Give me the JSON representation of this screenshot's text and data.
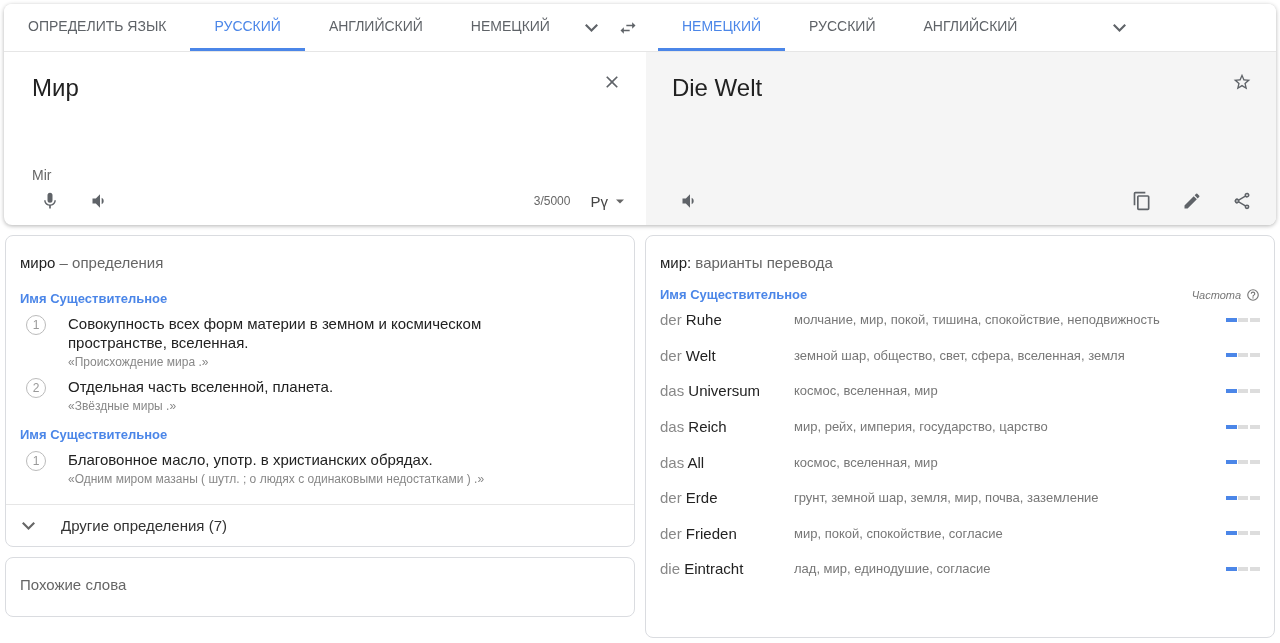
{
  "source_tabs": [
    {
      "label": "ОПРЕДЕЛИТЬ ЯЗЫК",
      "selected": false
    },
    {
      "label": "РУССКИЙ",
      "selected": true
    },
    {
      "label": "АНГЛИЙСКИЙ",
      "selected": false
    },
    {
      "label": "НЕМЕЦКИЙ",
      "selected": false
    }
  ],
  "target_tabs": [
    {
      "label": "НЕМЕЦКИЙ",
      "selected": true
    },
    {
      "label": "РУССКИЙ",
      "selected": false
    },
    {
      "label": "АНГЛИЙСКИЙ",
      "selected": false
    }
  ],
  "source": {
    "value": "Мир",
    "transliteration": "Mir",
    "char_count": "3/5000",
    "keyboard": "Рү"
  },
  "target": {
    "value": "Die Welt"
  },
  "definitions": {
    "word": "миро",
    "label": " – определения",
    "groups": [
      {
        "part_of_speech": "Имя Существительное",
        "items": [
          {
            "number": "1",
            "text": "Совокупность всех форм материи в земном и космическом пространстве, вселенная.",
            "example": "«Происхождение мира .»"
          },
          {
            "number": "2",
            "text": "Отдельная часть вселенной, планета.",
            "example": "«Звёздные миры .»"
          }
        ]
      },
      {
        "part_of_speech": "Имя Существительное",
        "items": [
          {
            "number": "1",
            "text": "Благовонное масло, употр. в христианских обрядах.",
            "example": "«Одним миром мазаны ( шутл. ; о людях с одинаковыми недостатками ) .»"
          }
        ]
      }
    ],
    "more": "Другие определения (7)"
  },
  "similar": {
    "title": "Похожие слова"
  },
  "translations": {
    "word": "мир:",
    "label": " варианты перевода",
    "part_of_speech": "Имя Существительное",
    "frequency_label": "Частота",
    "rows": [
      {
        "article": "der",
        "word": "Ruhe",
        "meanings": "молчание, мир, покой, тишина, спокойствие, неподвижность",
        "level": 0.33
      },
      {
        "article": "der",
        "word": "Welt",
        "meanings": "земной шар, общество, свет, сфера, вселенная, земля",
        "level": 0.33
      },
      {
        "article": "das",
        "word": "Universum",
        "meanings": "космос, вселенная, мир",
        "level": 0.33
      },
      {
        "article": "das",
        "word": "Reich",
        "meanings": "мир, рейх, империя, государство, царство",
        "level": 0.33
      },
      {
        "article": "das",
        "word": "All",
        "meanings": "космос, вселенная, мир",
        "level": 0.33
      },
      {
        "article": "der",
        "word": "Erde",
        "meanings": "грунт, земной шар, земля, мир, почва, заземление",
        "level": 0.33
      },
      {
        "article": "der",
        "word": "Frieden",
        "meanings": "мир, покой, спокойствие, согласие",
        "level": 0.33
      },
      {
        "article": "die",
        "word": "Eintracht",
        "meanings": "лад, мир, единодушие, согласие",
        "level": 0.33
      }
    ]
  }
}
